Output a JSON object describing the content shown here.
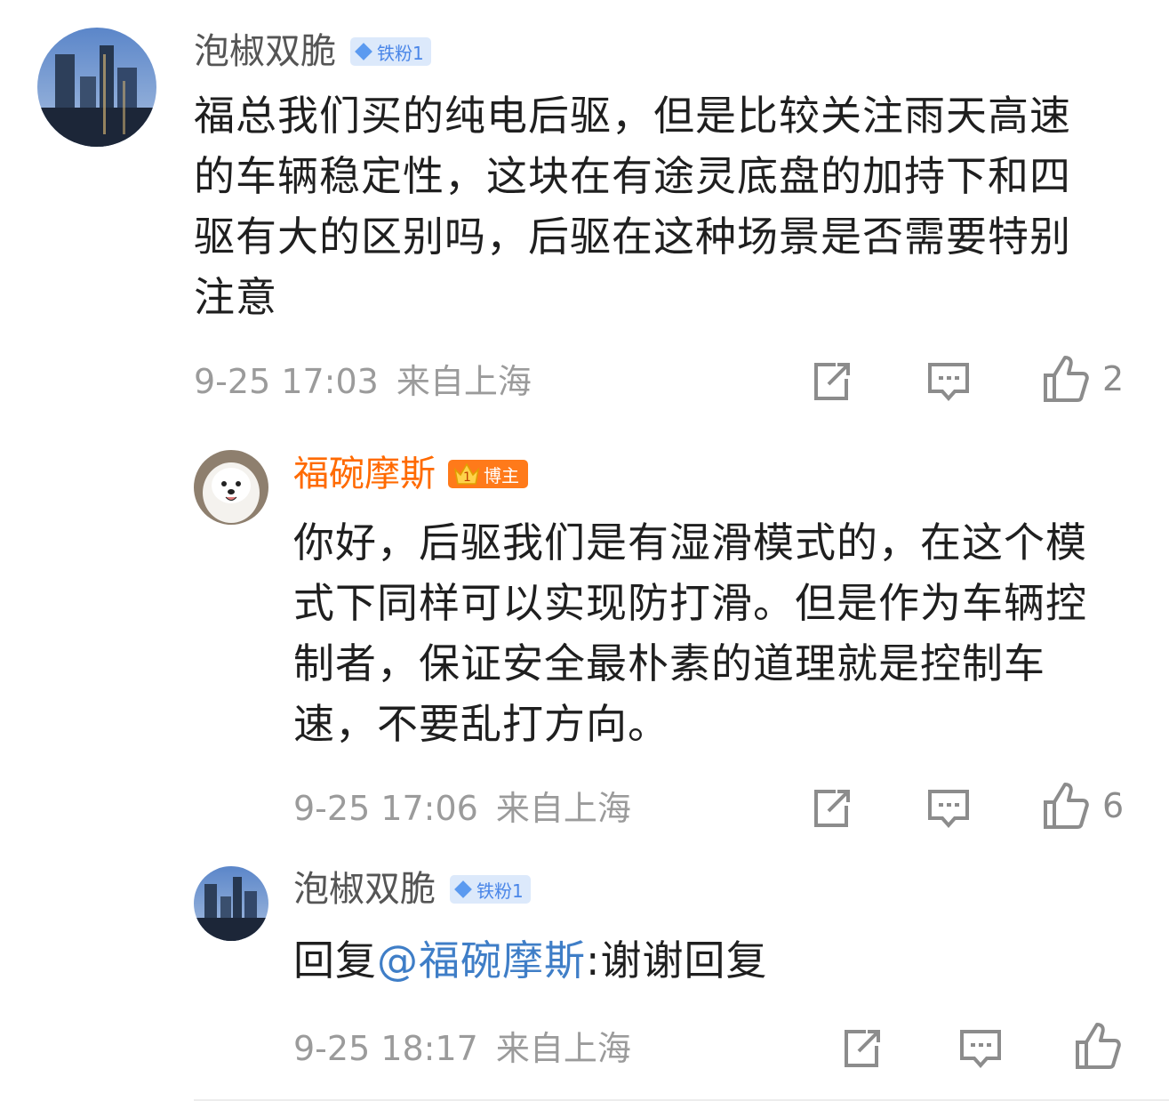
{
  "comments": [
    {
      "username": "泡椒双脆",
      "badge": "铁粉1",
      "text": "福总我们买的纯电后驱，但是比较关注雨天高速的车辆稳定性，这块在有途灵底盘的加持下和四驱有大的区别吗，后驱在这种场景是否需要特别注意",
      "time": "9-25 17:03",
      "location": "来自上海",
      "likes": "2"
    },
    {
      "username": "福碗摩斯",
      "badge_level": "1",
      "badge": "博主",
      "text": "你好，后驱我们是有湿滑模式的，在这个模式下同样可以实现防打滑。但是作为车辆控制者，保证安全最朴素的道理就是控制车速，不要乱打方向。",
      "time": "9-25 17:06",
      "location": "来自上海",
      "likes": "6"
    },
    {
      "username": "泡椒双脆",
      "badge": "铁粉1",
      "reply_prefix": "回复",
      "mention": "@福碗摩斯",
      "reply_text": ":谢谢回复",
      "time": "9-25 18:17",
      "location": "来自上海"
    }
  ],
  "colors": {
    "owner_name": "#ff6a00",
    "fan_badge_bg": "#dce9fb",
    "mention": "#3f7ec7"
  },
  "icons": [
    "share-icon",
    "comment-icon",
    "like-icon",
    "diamond-icon",
    "crown-icon"
  ]
}
